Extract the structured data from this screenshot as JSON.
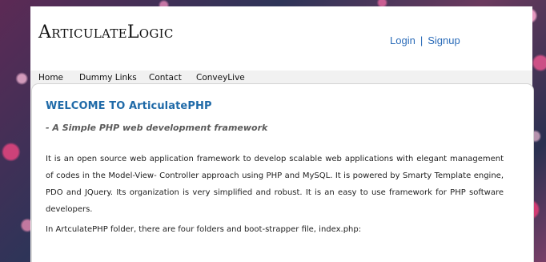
{
  "header": {
    "logo": "ArticulateLogic",
    "login_label": "Login",
    "separator": "|",
    "signup_label": "Signup"
  },
  "nav": {
    "items": [
      {
        "label": "Home"
      },
      {
        "label": "Dummy Links"
      },
      {
        "label": "Contact"
      },
      {
        "label": "ConveyLive"
      }
    ]
  },
  "content": {
    "title": "WELCOME TO ArticulatePHP",
    "tagline": "- A Simple PHP web development framework",
    "paragraph1": "It is an open source web application framework to develop scalable web applications with elegant management of codes in the Model-View- Controller approach using PHP and MySQL. It is powered by Smarty Template engine, PDO and JQuery. Its organization is very simplified and robust. It is an easy to use framework for PHP software developers.",
    "paragraph2": "In ArtculatePHP folder, there are four folders and boot-strapper file, index.php:"
  },
  "colors": {
    "link_blue": "#2a6bb8",
    "title_blue": "#1f6aa8",
    "tagline_gray": "#5a5a5a"
  }
}
